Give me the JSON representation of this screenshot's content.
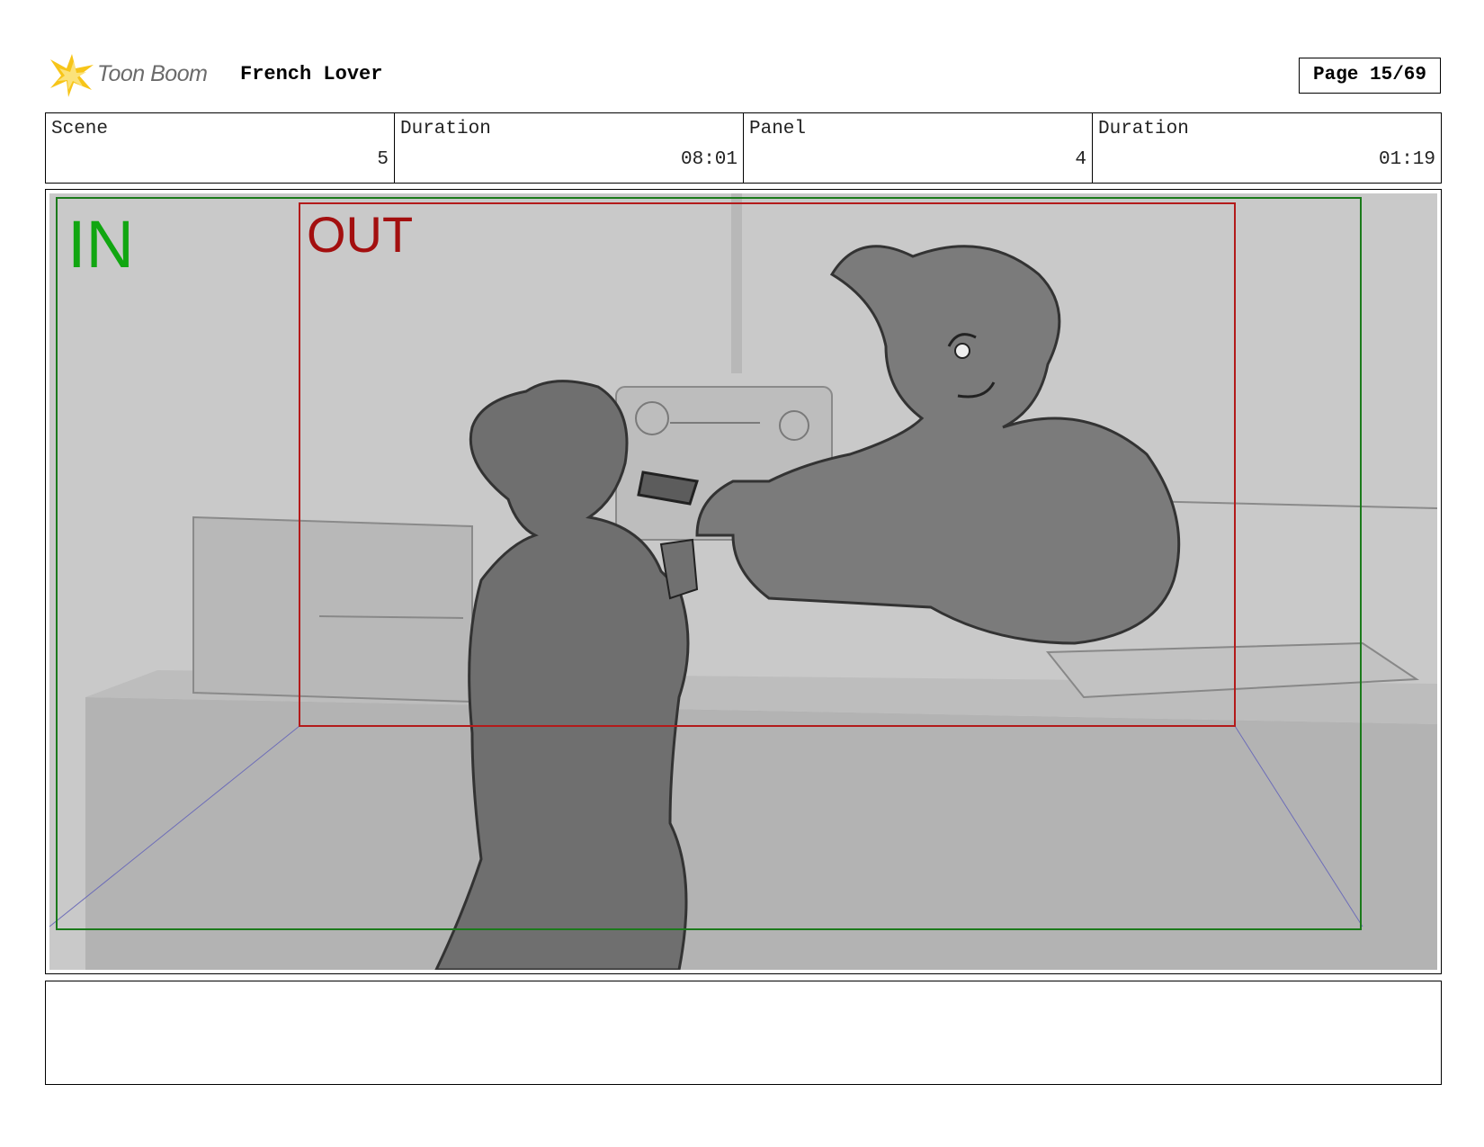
{
  "header": {
    "logo_text": "Toon Boom",
    "project_title": "French Lover",
    "page_label": "Page 15/69"
  },
  "info": {
    "scene_label": "Scene",
    "scene_value": "5",
    "scene_duration_label": "Duration",
    "scene_duration_value": "08:01",
    "panel_label": "Panel",
    "panel_value": "4",
    "panel_duration_label": "Duration",
    "panel_duration_value": "01:19"
  },
  "panel": {
    "in_label": "IN",
    "out_label": "OUT",
    "in_color": "#11a611",
    "out_color": "#a30f0f"
  },
  "notes": {
    "text": ""
  }
}
